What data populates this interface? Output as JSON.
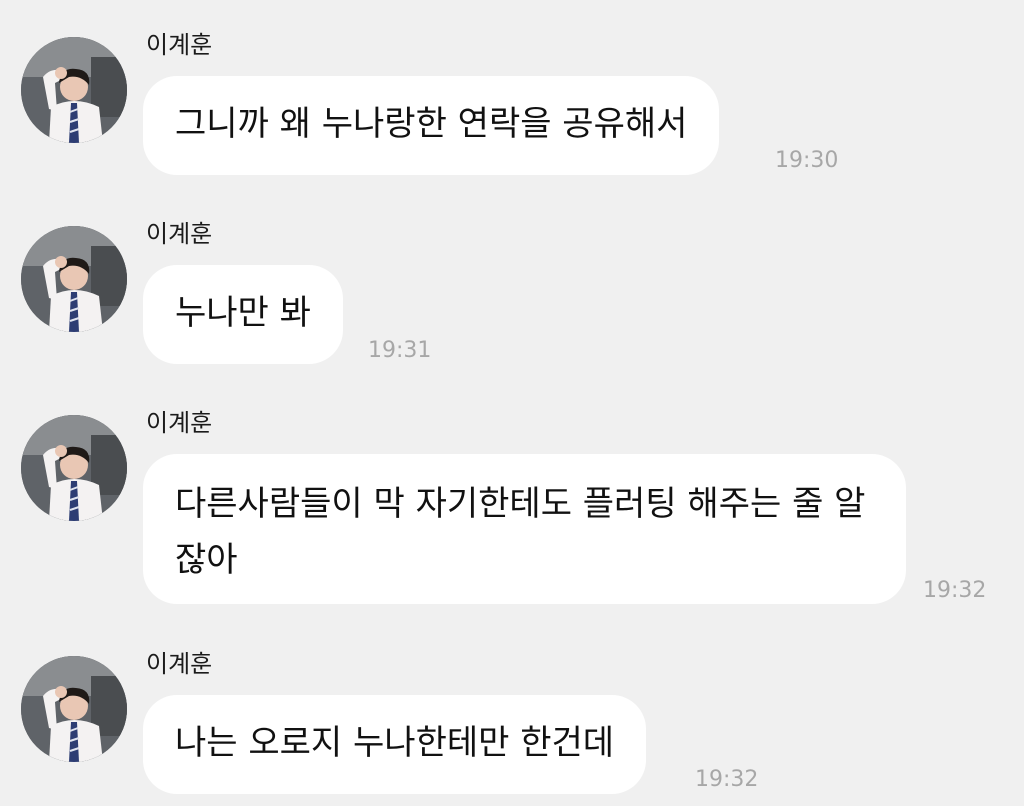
{
  "messages": [
    {
      "sender": "이계훈",
      "text": "그니까 왜 누나랑한 연락을 공유해서",
      "time": "19:30"
    },
    {
      "sender": "이계훈",
      "text": "누나만 봐",
      "time": "19:31"
    },
    {
      "sender": "이계훈",
      "text": "다른사람들이 막 자기한테도 플러팅 해주는 줄 알잖아",
      "time": "19:32"
    },
    {
      "sender": "이계훈",
      "text": "나는 오로지 누나한테만 한건데",
      "time": "19:32"
    }
  ],
  "colors": {
    "background": "#f0f0f0",
    "bubble": "#ffffff",
    "timestamp": "#a7a7a7"
  }
}
